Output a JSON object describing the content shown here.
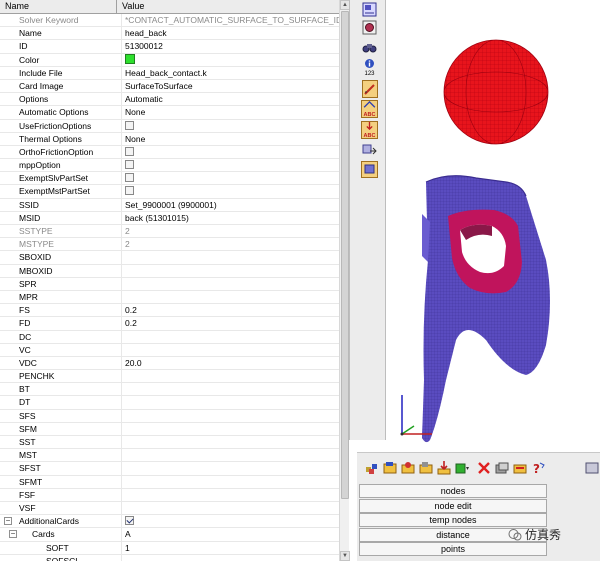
{
  "grid": {
    "header_name": "Name",
    "header_value": "Value",
    "rows": [
      {
        "name": "Solver Keyword",
        "value": "*CONTACT_AUTOMATIC_SURFACE_TO_SURFACE_ID",
        "gray": true
      },
      {
        "name": "Name",
        "value": "head_back"
      },
      {
        "name": "ID",
        "value": "51300012"
      },
      {
        "name": "Color",
        "swatch": true
      },
      {
        "name": "Include File",
        "value": "Head_back_contact.k"
      },
      {
        "name": "Card Image",
        "value": "SurfaceToSurface"
      },
      {
        "name": "Options",
        "value": "Automatic"
      },
      {
        "name": "Automatic Options",
        "value": "None"
      },
      {
        "name": "UseFrictionOptions",
        "checkbox": false
      },
      {
        "name": "Thermal Options",
        "value": "None"
      },
      {
        "name": "OrthoFrictionOption",
        "checkbox": false
      },
      {
        "name": "mppOption",
        "checkbox": false
      },
      {
        "name": "ExemptSlvPartSet",
        "checkbox": false
      },
      {
        "name": "ExemptMstPartSet",
        "checkbox": false
      },
      {
        "name": "SSID",
        "value": "Set_9900001 (9900001)"
      },
      {
        "name": "MSID",
        "value": "back (51301015)"
      },
      {
        "name": "SSTYPE",
        "value": "2",
        "gray": true
      },
      {
        "name": "MSTYPE",
        "value": "2",
        "gray": true
      },
      {
        "name": "SBOXID",
        "value": ""
      },
      {
        "name": "MBOXID",
        "value": ""
      },
      {
        "name": "SPR",
        "value": ""
      },
      {
        "name": "MPR",
        "value": ""
      },
      {
        "name": "FS",
        "value": "0.2"
      },
      {
        "name": "FD",
        "value": "0.2"
      },
      {
        "name": "DC",
        "value": ""
      },
      {
        "name": "VC",
        "value": ""
      },
      {
        "name": "VDC",
        "value": "20.0"
      },
      {
        "name": "PENCHK",
        "value": ""
      },
      {
        "name": "BT",
        "value": ""
      },
      {
        "name": "DT",
        "value": ""
      },
      {
        "name": "SFS",
        "value": ""
      },
      {
        "name": "SFM",
        "value": ""
      },
      {
        "name": "SST",
        "value": ""
      },
      {
        "name": "MST",
        "value": ""
      },
      {
        "name": "SFST",
        "value": ""
      },
      {
        "name": "SFMT",
        "value": ""
      },
      {
        "name": "FSF",
        "value": ""
      },
      {
        "name": "VSF",
        "value": ""
      },
      {
        "name": "AdditionalCards",
        "checkbox": true,
        "group": "minus"
      },
      {
        "name": "Cards",
        "value": "A",
        "group": "minus",
        "level": 1
      },
      {
        "name": "SOFT",
        "value": "1",
        "level": 2
      },
      {
        "name": "SOFSCL",
        "value": "",
        "level": 2
      }
    ]
  },
  "toolbar_vertical": {
    "label_123": "123",
    "abc_1": "ABC",
    "abc_2": "ABC"
  },
  "panel": {
    "buttons": [
      "nodes",
      "node edit",
      "temp nodes",
      "distance",
      "points"
    ]
  },
  "watermark": {
    "text": "仿真秀"
  },
  "colors": {
    "sphere": "#e8141c",
    "mesh_red": "#c00010",
    "part_purple": "#5a4cc0",
    "part_pink": "#c0145c",
    "swatch_green": "#2ee02e"
  }
}
